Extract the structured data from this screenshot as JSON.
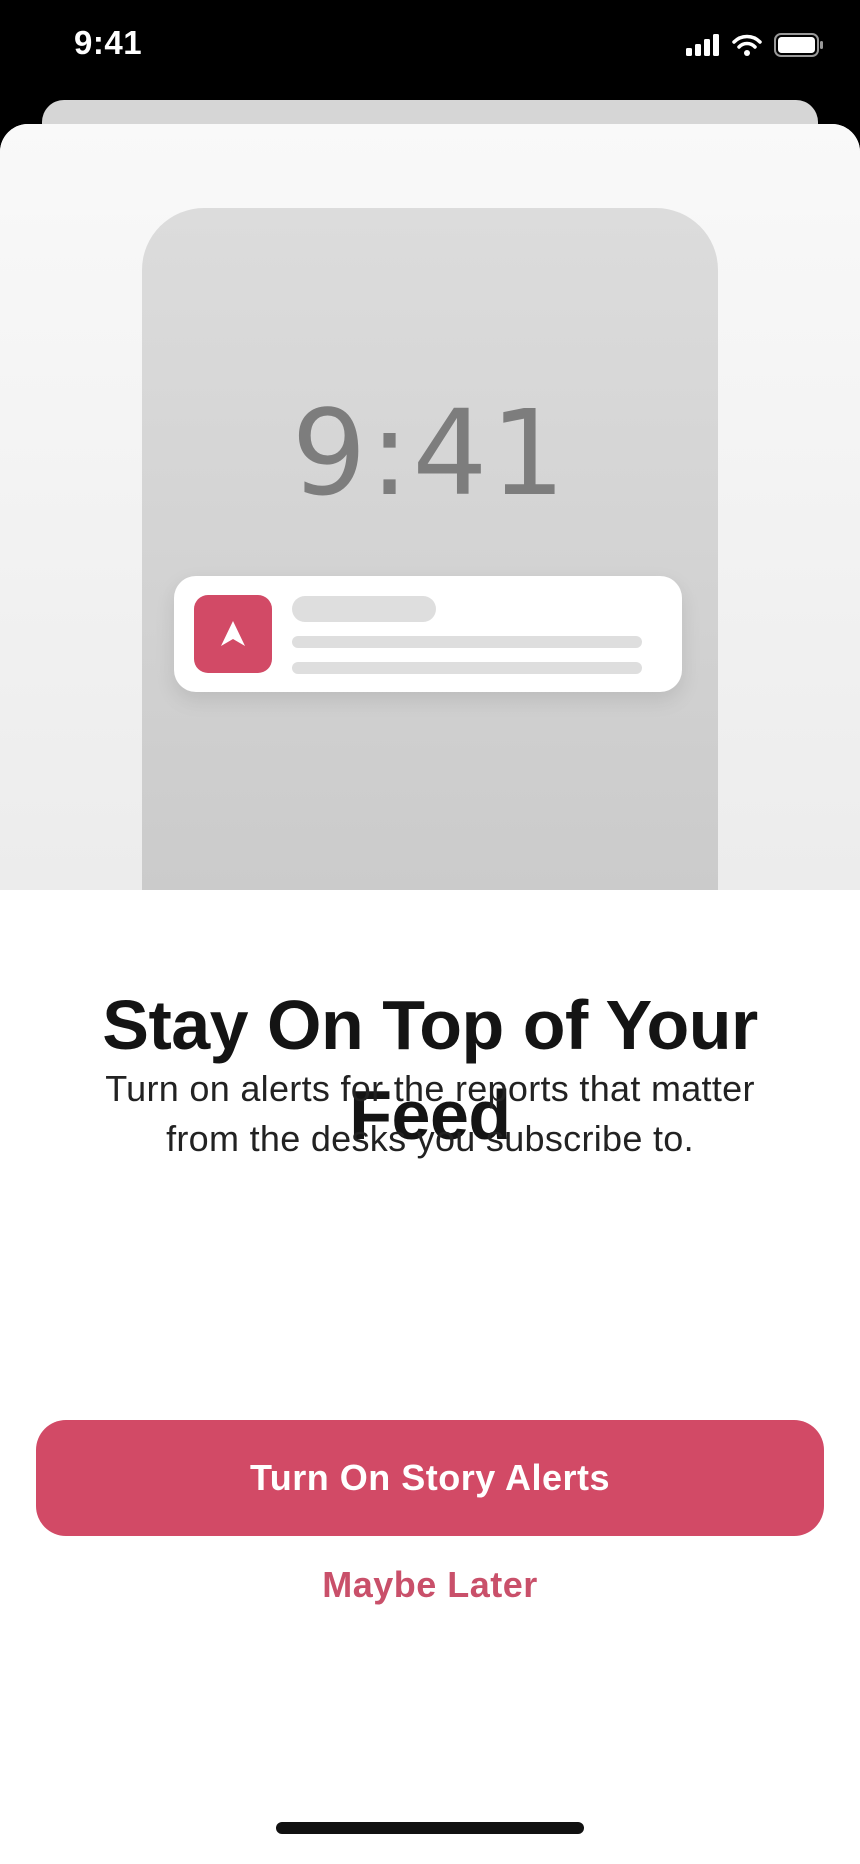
{
  "status_bar": {
    "time": "9:41"
  },
  "hero": {
    "phone_time": "9:41",
    "accent_color": "#d24a66",
    "notification_icon": "navigation-arrow-icon"
  },
  "content": {
    "headline": "Stay On Top of Your Feed",
    "description": "Turn on alerts for the reports that matter from the desks you subscribe to."
  },
  "actions": {
    "primary_label": "Turn On Story Alerts",
    "secondary_label": "Maybe Later"
  }
}
